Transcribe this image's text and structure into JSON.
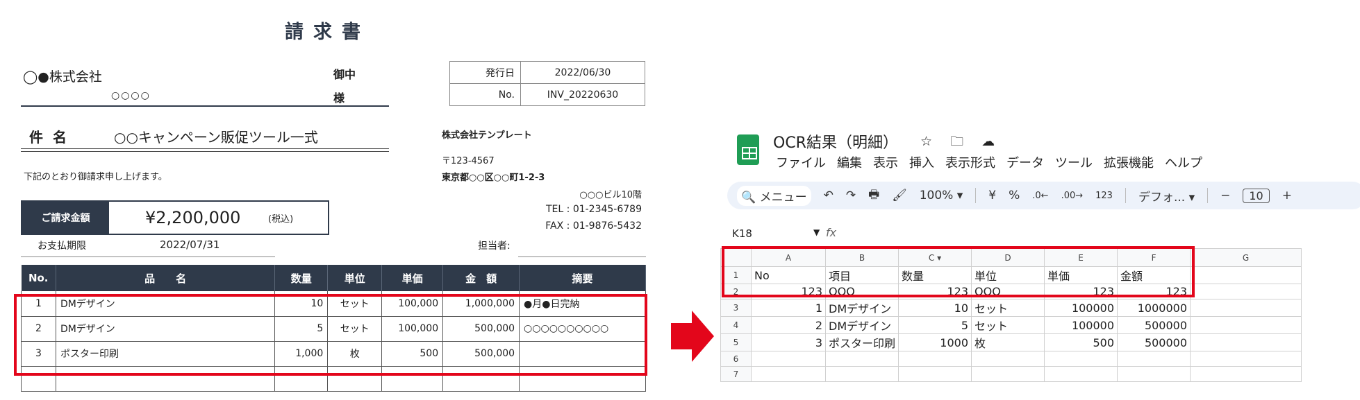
{
  "invoice": {
    "title": "請求書",
    "client": "◯●株式会社",
    "client_sub": "○○○○",
    "honorific1": "御中",
    "honorific2": "様",
    "meta": [
      {
        "label": "発行日",
        "value": "2022/06/30"
      },
      {
        "label": "No.",
        "value": "INV_20220630"
      }
    ],
    "subject_label": "件名",
    "subject": "○○キャンペーン販促ツール一式",
    "company": "株式会社テンプレート",
    "postal": "〒123-4567",
    "address": "東京都○○区○○町1-2-3",
    "building": "○○○ビル10階",
    "tel": "TEL : 01-2345-6789",
    "fax": "FAX : 01-9876-5432",
    "intro": "下記のとおり御請求申し上げます。",
    "amount_label": "ご請求金額",
    "amount": "¥2,200,000",
    "tax_note": "(税込)",
    "due_label": "お支払期限",
    "due_date": "2022/07/31",
    "staff_label": "担当者:",
    "columns": [
      "No.",
      "品　　名",
      "数量",
      "単位",
      "単価",
      "金　額",
      "摘要"
    ],
    "rows": [
      [
        "1",
        "DMデザイン",
        "10",
        "セット",
        "100,000",
        "1,000,000",
        "●月●日完納"
      ],
      [
        "2",
        "DMデザイン",
        "5",
        "セット",
        "100,000",
        "500,000",
        "○○○○○○○○○○"
      ],
      [
        "3",
        "ポスター印刷",
        "1,000",
        "枚",
        "500",
        "500,000",
        ""
      ]
    ]
  },
  "sheets": {
    "doc_title": "OCR結果（明細）",
    "doc_icons": "☆ 🗀 ☁",
    "menu": [
      "ファイル",
      "編集",
      "表示",
      "挿入",
      "表示形式",
      "データ",
      "ツール",
      "拡張機能",
      "ヘルプ"
    ],
    "toolbar": {
      "search": "🔍 メニュー",
      "undo": "↶",
      "redo": "↷",
      "print": "🖶",
      "paint": "🖌",
      "zoom": "100%  ▾",
      "yen": "¥",
      "pct": "%",
      "dec_down": ".0←",
      "dec_up": ".00→",
      "fmt123": "123",
      "font": "デフォ...  ▾",
      "minus": "−",
      "size": "10",
      "plus": "+"
    },
    "cell_ref": "K18",
    "fx": "fx",
    "col_headers": [
      "A",
      "B",
      "C  ▾",
      "D",
      "E",
      "F",
      "G"
    ],
    "grid": [
      [
        "1",
        "No",
        "項目",
        "数量",
        "単位",
        "単価",
        "金額",
        ""
      ],
      [
        "2",
        "123",
        "OOO",
        "123",
        "OOO",
        "123",
        "123",
        ""
      ],
      [
        "3",
        "1",
        "DMデザイン",
        "10",
        "セット",
        "100000",
        "1000000",
        ""
      ],
      [
        "4",
        "2",
        "DMデザイン",
        "5",
        "セット",
        "100000",
        "500000",
        ""
      ],
      [
        "5",
        "3",
        "ポスター印刷",
        "1000",
        "枚",
        "500",
        "500000",
        ""
      ],
      [
        "6",
        "",
        "",
        "",
        "",
        "",
        "",
        ""
      ],
      [
        "7",
        "",
        "",
        "",
        "",
        "",
        "",
        ""
      ]
    ]
  },
  "colors": {
    "accent_red": "#e3061b",
    "invoice_navy": "#2f3a4a",
    "sheets_green": "#1f9d55"
  }
}
